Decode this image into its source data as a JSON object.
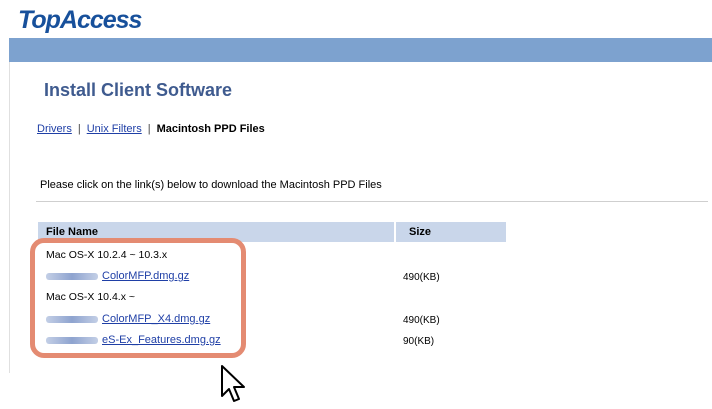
{
  "app": {
    "logo_text": "TopAccess"
  },
  "page": {
    "title": "Install Client Software"
  },
  "tabs": [
    {
      "label": "Drivers",
      "active": false
    },
    {
      "label": "Unix Filters",
      "active": false
    },
    {
      "label": "Macintosh PPD Files",
      "active": true
    }
  ],
  "separator": "|",
  "instruction": "Please click on the link(s) below to download the Macintosh PPD Files",
  "table": {
    "headers": {
      "file_name": "File Name",
      "size": "Size"
    },
    "groups": [
      {
        "label": "Mac OS-X 10.2.4 ~ 10.3.x",
        "files": [
          {
            "name": "ColorMFP.dmg.gz",
            "size": "490(KB)"
          }
        ]
      },
      {
        "label": "Mac OS-X 10.4.x ~",
        "files": [
          {
            "name": "ColorMFP_X4.dmg.gz",
            "size": "490(KB)"
          },
          {
            "name": "eS-Ex_Features.dmg.gz",
            "size": "90(KB)"
          }
        ]
      }
    ]
  },
  "colors": {
    "brand": "#17509b",
    "bar": "#7da2cf",
    "header_bg": "#c9d6ea",
    "highlight": "#e48b72",
    "link": "#1f3fa6"
  },
  "icons": {
    "cursor": "mouse-pointer-icon"
  }
}
